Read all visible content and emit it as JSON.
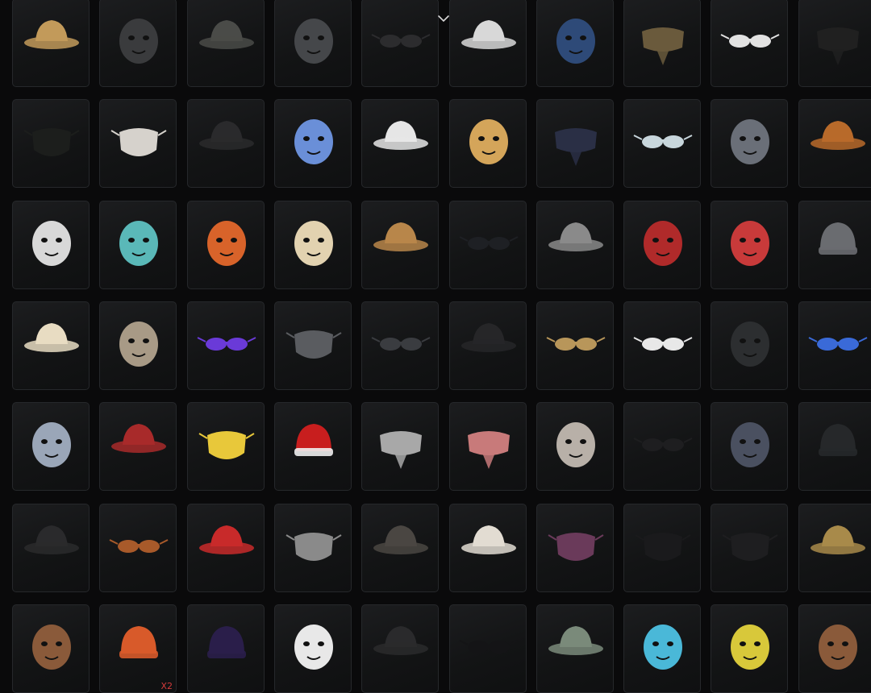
{
  "inventory": {
    "items": [
      {
        "icon": "straw-sun-hat-icon",
        "color": "#c29a5a"
      },
      {
        "icon": "headset-cap-icon",
        "color": "#3a3b3d"
      },
      {
        "icon": "quilted-flat-cap-icon",
        "color": "#4a4b48"
      },
      {
        "icon": "pilot-helmet-icon",
        "color": "#45474a"
      },
      {
        "icon": "eye-visor-icon",
        "color": "#2c2c2e"
      },
      {
        "icon": "white-baseball-cap-icon",
        "color": "#d8d8d8"
      },
      {
        "icon": "blue-gas-mask-icon",
        "color": "#2e4a78"
      },
      {
        "icon": "camo-face-scarf-icon",
        "color": "#6a5a3c"
      },
      {
        "icon": "white-sunglasses-icon",
        "color": "#e2e2e2"
      },
      {
        "icon": "black-bandana-icon",
        "color": "#202020"
      },
      {
        "icon": "black-face-mask-icon",
        "color": "#1c1e1c"
      },
      {
        "icon": "moon-face-mask-icon",
        "color": "#d6d2cc"
      },
      {
        "icon": "black-flat-cap-icon",
        "color": "#2a2a2c"
      },
      {
        "icon": "pink-cat-eye-mask-icon",
        "color": "#6a8fd8"
      },
      {
        "icon": "officer-cap-icon",
        "color": "#e6e6e6"
      },
      {
        "icon": "astronaut-helmet-icon",
        "color": "#d4a55a"
      },
      {
        "icon": "navy-headband-icon",
        "color": "#2a2f45"
      },
      {
        "icon": "respirator-goggles-icon",
        "color": "#c8d6dc"
      },
      {
        "icon": "dinosaur-head-icon",
        "color": "#6a6f78"
      },
      {
        "icon": "cow-print-hat-icon",
        "color": "#b86a2a"
      },
      {
        "icon": "cow-print-helmet-icon",
        "color": "#d8d8d8"
      },
      {
        "icon": "owl-mask-icon",
        "color": "#5ab8b8"
      },
      {
        "icon": "fox-mask-icon",
        "color": "#d8632a"
      },
      {
        "icon": "pith-helmet-icon",
        "color": "#e2d2b0"
      },
      {
        "icon": "aviator-cap-icon",
        "color": "#b8864a"
      },
      {
        "icon": "black-sunglasses-icon",
        "color": "#1e2024"
      },
      {
        "icon": "red-band-top-hat-icon",
        "color": "#8a8a8a"
      },
      {
        "icon": "luchador-mask-icon",
        "color": "#b02a2a"
      },
      {
        "icon": "alien-mask-icon",
        "color": "#c83a3a"
      },
      {
        "icon": "grey-beanie-icon",
        "color": "#6a6c70"
      },
      {
        "icon": "cream-sun-hat-icon",
        "color": "#e8dcc2"
      },
      {
        "icon": "tribal-mask-icon",
        "color": "#a89a86"
      },
      {
        "icon": "purple-round-glasses-icon",
        "color": "#6a3ad8"
      },
      {
        "icon": "grey-face-mask-icon",
        "color": "#5a5c60"
      },
      {
        "icon": "aviator-goggles-icon",
        "color": "#3a3c40"
      },
      {
        "icon": "black-leather-cap-icon",
        "color": "#262628"
      },
      {
        "icon": "gold-sport-glasses-icon",
        "color": "#b8965a"
      },
      {
        "icon": "shutter-shades-icon",
        "color": "#e8e8e8"
      },
      {
        "icon": "gas-mask-icon",
        "color": "#2c2e30"
      },
      {
        "icon": "steampunk-goggles-icon",
        "color": "#3a6ad8"
      },
      {
        "icon": "husky-mask-icon",
        "color": "#9aa6b8"
      },
      {
        "icon": "red-beret-icon",
        "color": "#a82a2a"
      },
      {
        "icon": "gold-face-mask-icon",
        "color": "#e8c83a"
      },
      {
        "icon": "santa-hat-icon",
        "color": "#c81e1e"
      },
      {
        "icon": "grey-scarf-icon",
        "color": "#a8a8a8"
      },
      {
        "icon": "pink-scarf-icon",
        "color": "#c87a7a"
      },
      {
        "icon": "mannequin-head-icon",
        "color": "#b8b0a8"
      },
      {
        "icon": "wrap-sunglasses-icon",
        "color": "#1e1e20"
      },
      {
        "icon": "spiked-mask-icon",
        "color": "#4a5060"
      },
      {
        "icon": "black-beanie-icon",
        "color": "#26282a"
      },
      {
        "icon": "leather-peaked-cap-icon",
        "color": "#2a2a2c"
      },
      {
        "icon": "orange-frame-glasses-icon",
        "color": "#a85a2a"
      },
      {
        "icon": "red-baseball-cap-icon",
        "color": "#c82a2a"
      },
      {
        "icon": "half-respirator-icon",
        "color": "#8a8a8a"
      },
      {
        "icon": "worn-peaked-cap-icon",
        "color": "#4a4642"
      },
      {
        "icon": "shower-cap-icon",
        "color": "#e2dcd2"
      },
      {
        "icon": "half-mask-respirator-icon",
        "color": "#6a3a5a"
      },
      {
        "icon": "printed-face-mask-icon",
        "color": "#1a1a1c"
      },
      {
        "icon": "black-face-mask-2-icon",
        "color": "#1e1e20"
      },
      {
        "icon": "bucket-hat-icon",
        "color": "#a88a4a"
      },
      {
        "icon": "reindeer-mask-icon",
        "color": "#8a5a3a"
      },
      {
        "icon": "knit-winter-hat-icon",
        "color": "#d85a2a"
      },
      {
        "icon": "purple-beanie-icon",
        "color": "#2a1e4a"
      },
      {
        "icon": "chicken-mask-icon",
        "color": "#e8e8e8"
      },
      {
        "icon": "orange-bill-cap-icon",
        "color": "#2a2a2c"
      },
      {
        "icon": "oversized-sunglasses-icon",
        "color": "#141416"
      },
      {
        "icon": "green-baseball-cap-icon",
        "color": "#7a8a7a"
      },
      {
        "icon": "blue-dragon-mask-icon",
        "color": "#4ab8d8"
      },
      {
        "icon": "yellow-dino-mask-icon",
        "color": "#d8c83a"
      },
      {
        "icon": "ape-mask-icon",
        "color": "#8a5a3a"
      }
    ],
    "badges": [
      {
        "item_index": 61,
        "text": "X2"
      }
    ]
  },
  "ui": {
    "expand_icon": "chevron-down-icon",
    "chevron_color": "#d8d8d8"
  }
}
